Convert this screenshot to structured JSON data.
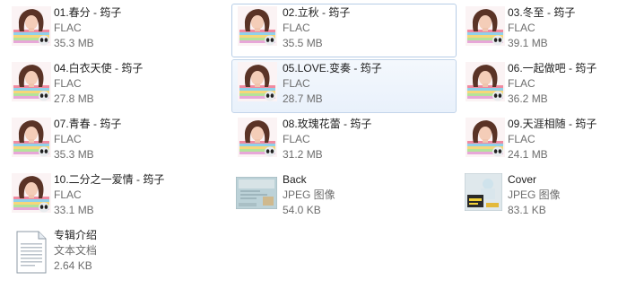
{
  "colors": {
    "selection_border": "#c3d5ea",
    "hover_border": "#b7cde6",
    "secondary_text": "#6d6d6d"
  },
  "files": [
    {
      "name": "01.春分 - 筠子",
      "type": "FLAC",
      "size": "35.3 MB",
      "icon": "album-cover-thumbnail"
    },
    {
      "name": "02.立秋 - 筠子",
      "type": "FLAC",
      "size": "35.5 MB",
      "icon": "album-cover-thumbnail"
    },
    {
      "name": "03.冬至 - 筠子",
      "type": "FLAC",
      "size": "39.1 MB",
      "icon": "album-cover-thumbnail"
    },
    {
      "name": "04.白衣天使 - 筠子",
      "type": "FLAC",
      "size": "27.8 MB",
      "icon": "album-cover-thumbnail"
    },
    {
      "name": "05.LOVE.变奏 - 筠子",
      "type": "FLAC",
      "size": "28.7 MB",
      "icon": "album-cover-thumbnail"
    },
    {
      "name": "06.一起做吧 - 筠子",
      "type": "FLAC",
      "size": "36.2 MB",
      "icon": "album-cover-thumbnail"
    },
    {
      "name": "07.青春 - 筠子",
      "type": "FLAC",
      "size": "35.3 MB",
      "icon": "album-cover-thumbnail"
    },
    {
      "name": "08.玫瑰花蕾 - 筠子",
      "type": "FLAC",
      "size": "31.2 MB",
      "icon": "album-cover-thumbnail"
    },
    {
      "name": "09.天涯相随 - 筠子",
      "type": "FLAC",
      "size": "24.1 MB",
      "icon": "album-cover-thumbnail"
    },
    {
      "name": "10.二分之一爱情 - 筠子",
      "type": "FLAC",
      "size": "33.1 MB",
      "icon": "album-cover-thumbnail"
    },
    {
      "name": "Back",
      "type": "JPEG 图像",
      "size": "54.0 KB",
      "icon": "jpeg-thumbnail"
    },
    {
      "name": "Cover",
      "type": "JPEG 图像",
      "size": "83.1 KB",
      "icon": "jpeg-thumbnail"
    },
    {
      "name": "专辑介绍",
      "type": "文本文档",
      "size": "2.64 KB",
      "icon": "text-document-icon"
    }
  ]
}
